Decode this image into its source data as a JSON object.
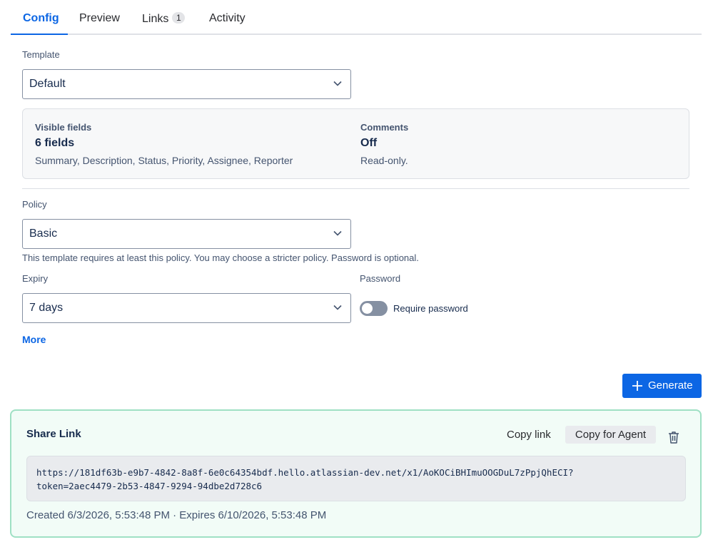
{
  "tabs": [
    {
      "label": "Config",
      "active": true
    },
    {
      "label": "Preview",
      "active": false
    },
    {
      "label": "Links",
      "badge": "1",
      "active": false
    },
    {
      "label": "Activity",
      "active": false
    }
  ],
  "template": {
    "label": "Template",
    "value": "Default"
  },
  "info": {
    "visible_fields_heading": "Visible fields",
    "visible_fields_count": "6 fields",
    "visible_fields_list": "Summary, Description, Status, Priority, Assignee, Reporter",
    "comments_heading": "Comments",
    "comments_value": "Off",
    "comments_desc": "Read-only."
  },
  "policy": {
    "label": "Policy",
    "value": "Basic",
    "helper": "This template requires at least this policy. You may choose a stricter policy. Password is optional."
  },
  "expiry": {
    "label": "Expiry",
    "value": "7 days"
  },
  "password": {
    "label": "Password",
    "toggle_label": "Require password",
    "enabled": false
  },
  "more_link": "More",
  "generate_button": "Generate",
  "share": {
    "title": "Share Link",
    "copy_link": "Copy link",
    "copy_agent": "Copy for Agent",
    "url_line1": "https://181df63b-e9b7-4842-8a8f-6e0c64354bdf.hello.atlassian-dev.net/x1/AoKOCiBHImuOOGDuL7zPpjQhECI?",
    "url_line2": "token=2aec4479-2b53-4847-9294-94dbe2d728c6",
    "meta": "Created 6/3/2026, 5:53:48 PM · Expires 6/10/2026, 5:53:48 PM"
  },
  "colors": {
    "accent": "#0c66e4",
    "share_bg": "#f2fcf7",
    "share_border": "#9fe0c4"
  }
}
